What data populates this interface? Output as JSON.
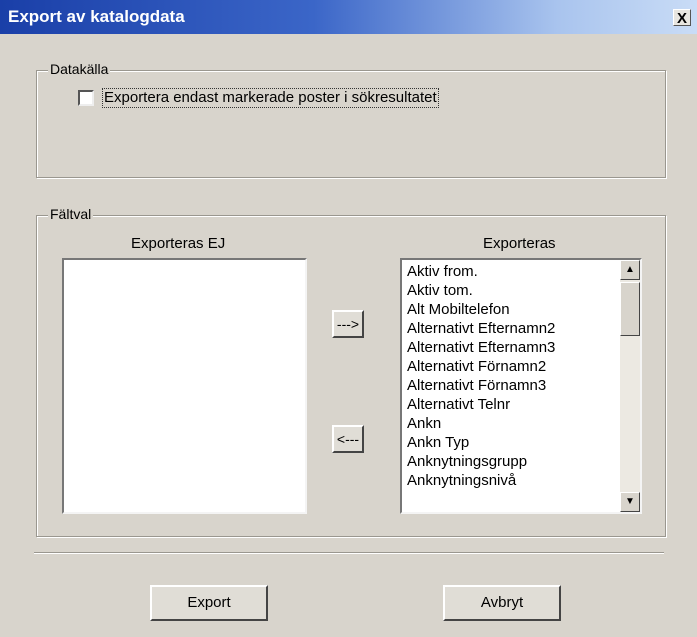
{
  "window": {
    "title": "Export av katalogdata",
    "close_label": "X"
  },
  "datasource": {
    "legend": "Datakälla",
    "checkbox_label": "Exportera endast markerade poster i sökresultatet",
    "checked": false
  },
  "fieldselection": {
    "legend": "Fältval",
    "left_header": "Exporteras EJ",
    "right_header": "Exporteras",
    "left_items": [],
    "right_items": [
      "Aktiv from.",
      "Aktiv tom.",
      "Alt Mobiltelefon",
      "Alternativt Efternamn2",
      "Alternativt Efternamn3",
      "Alternativt Förnamn2",
      "Alternativt Förnamn3",
      "Alternativt Telnr",
      "Ankn",
      "Ankn Typ",
      "Anknytningsgrupp",
      "Anknytningsnivå"
    ],
    "move_right_label": "--->",
    "move_left_label": "<---"
  },
  "footer": {
    "export_label": "Export",
    "cancel_label": "Avbryt"
  }
}
